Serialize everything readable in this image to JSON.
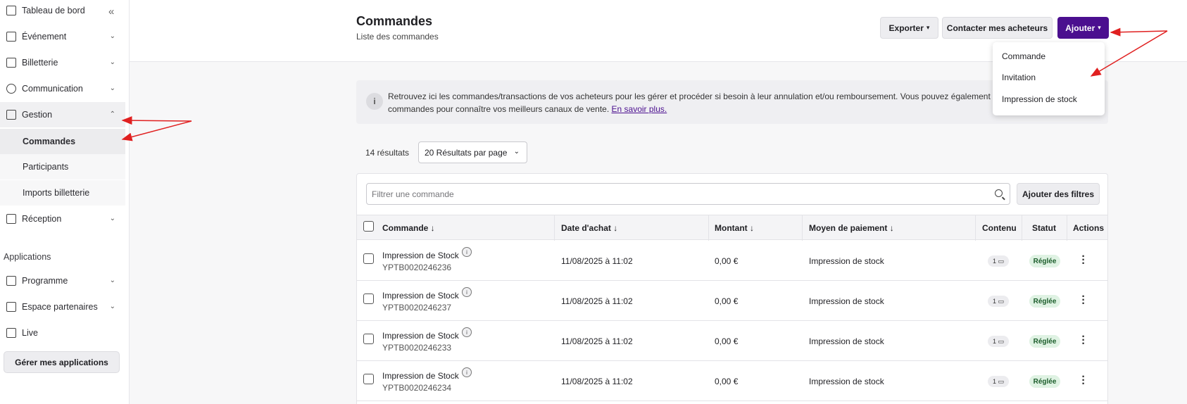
{
  "sidebar": {
    "items": [
      {
        "label": "Tableau de bord",
        "icon": "dashboard-icon"
      },
      {
        "label": "Événement",
        "icon": "event-icon"
      },
      {
        "label": "Billetterie",
        "icon": "ticket-icon"
      },
      {
        "label": "Communication",
        "icon": "chat-icon"
      },
      {
        "label": "Gestion",
        "icon": "management-icon"
      },
      {
        "label": "Réception",
        "icon": "reception-icon"
      }
    ],
    "gestion_sub": [
      "Commandes",
      "Participants",
      "Imports billetterie"
    ],
    "apps_title": "Applications",
    "apps": [
      {
        "label": "Programme",
        "icon": "calendar-icon"
      },
      {
        "label": "Espace partenaires",
        "icon": "partners-icon"
      },
      {
        "label": "Live",
        "icon": "cast-icon"
      }
    ],
    "manage_apps": "Gérer mes applications"
  },
  "header": {
    "title": "Commandes",
    "subtitle": "Liste des commandes",
    "export_label": "Exporter",
    "contact_label": "Contacter mes acheteurs",
    "add_label": "Ajouter"
  },
  "dropdown": [
    "Commande",
    "Invitation",
    "Impression de stock"
  ],
  "info": {
    "text": "Retrouvez ici les commandes/transactions de vos acheteurs pour les gérer et procéder si besoin à leur annulation et/ou remboursement. Vous pouvez également suivre la provenance de vos",
    "text2": "commandes pour connaître vos meilleurs canaux de vente.",
    "link": "En savoir plus."
  },
  "results": {
    "count": "14 résultats",
    "per_page": "20 Résultats par page"
  },
  "filter": {
    "placeholder": "Filtrer une commande",
    "add_filters": "Ajouter des filtres"
  },
  "table": {
    "headers": [
      "Commande",
      "Date d'achat",
      "Montant",
      "Moyen de paiement",
      "Contenu",
      "Statut",
      "Actions"
    ],
    "rows": [
      {
        "name": "Impression de Stock",
        "ref": "YPTB0020246236",
        "date": "11/08/2025 à 11:02",
        "amount": "0,00 €",
        "payment": "Impression de stock",
        "content": "1",
        "status": "Réglée"
      },
      {
        "name": "Impression de Stock",
        "ref": "YPTB0020246237",
        "date": "11/08/2025 à 11:02",
        "amount": "0,00 €",
        "payment": "Impression de stock",
        "content": "1",
        "status": "Réglée"
      },
      {
        "name": "Impression de Stock",
        "ref": "YPTB0020246233",
        "date": "11/08/2025 à 11:02",
        "amount": "0,00 €",
        "payment": "Impression de stock",
        "content": "1",
        "status": "Réglée"
      },
      {
        "name": "Impression de Stock",
        "ref": "YPTB0020246234",
        "date": "11/08/2025 à 11:02",
        "amount": "0,00 €",
        "payment": "Impression de stock",
        "content": "1",
        "status": "Réglée"
      }
    ]
  },
  "colors": {
    "primary": "#4b0f8f",
    "annotation": "#e02020",
    "status_bg": "#dff2e3"
  }
}
